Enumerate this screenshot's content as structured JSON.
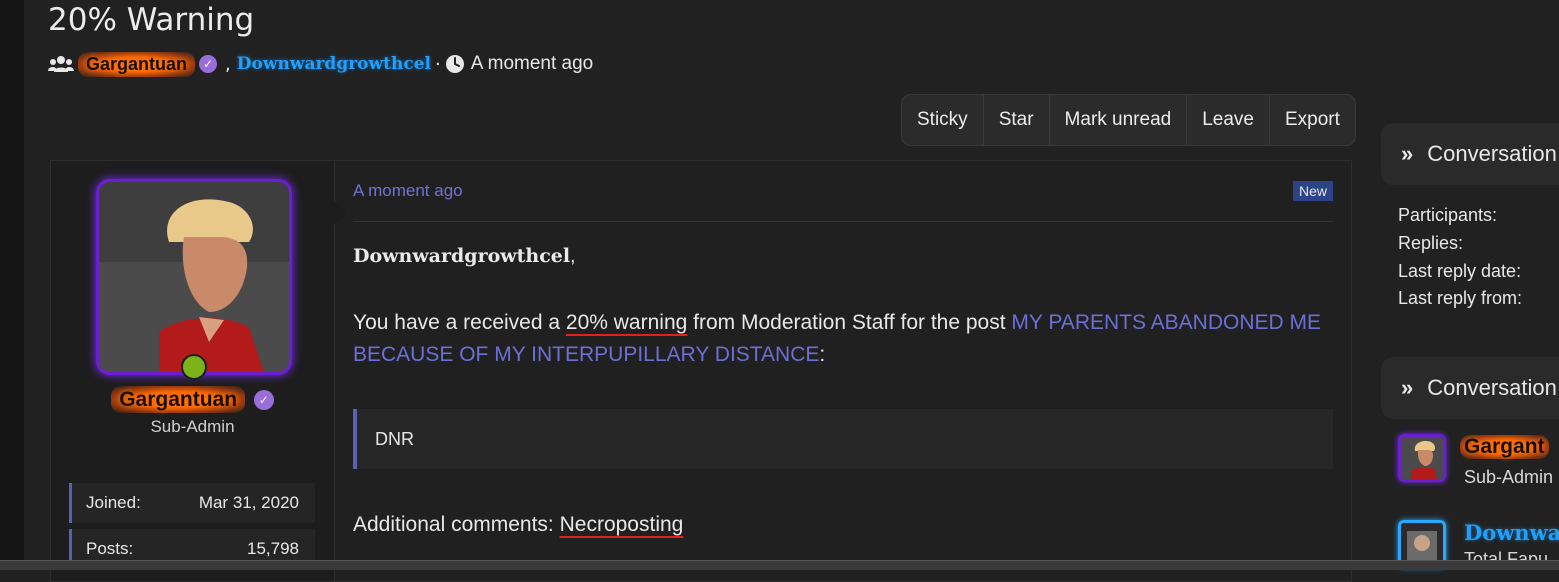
{
  "thread": {
    "title": "20% Warning",
    "participants": [
      "Gargantuan",
      "Downwardgrowthcel"
    ],
    "separator": ",",
    "dot": "·",
    "time": "A moment ago"
  },
  "actions": [
    "Sticky",
    "Star",
    "Mark unread",
    "Leave",
    "Export"
  ],
  "author": {
    "name": "Gargantuan",
    "title": "Sub-Admin",
    "verified_glyph": "✓",
    "stats": [
      {
        "label": "Joined:",
        "value": "Mar 31, 2020"
      },
      {
        "label": "Posts:",
        "value": "15,798"
      }
    ]
  },
  "post": {
    "time": "A moment ago",
    "badge": "New",
    "greeting_name": "Downwardgrowthcel",
    "greeting_comma": ",",
    "line_prefix": "You have a received a ",
    "warning_text": "20% warning",
    "line_middle": " from Moderation Staff for the post ",
    "link_text": "MY PARENTS ABANDONED ME BECAUSE OF MY INTERPUPILLARY DISTANCE",
    "line_suffix": ":",
    "quote": "DNR",
    "comments_label": "Additional comments: ",
    "comments_value": "Necroposting"
  },
  "sidebar": {
    "info_title": "Conversation",
    "info_labels": [
      "Participants:",
      "Replies:",
      "Last reply date:",
      "Last reply from:"
    ],
    "participants_title": "Conversation",
    "participants": [
      {
        "name": "Gargant",
        "sub": "Sub-Admin"
      },
      {
        "name": "Downwa",
        "sub": "Total Fapu"
      }
    ]
  },
  "colors": {
    "accent": "#6a70d6",
    "glow_orange": "#ff6a00",
    "verified_purple": "#9a6ed8",
    "online_green": "#7bb31a",
    "new_badge": "#2c4487",
    "underline_red": "#e02020"
  },
  "icons": [
    "users-icon",
    "verified-icon",
    "clock-icon",
    "chevron-double-right-icon"
  ]
}
